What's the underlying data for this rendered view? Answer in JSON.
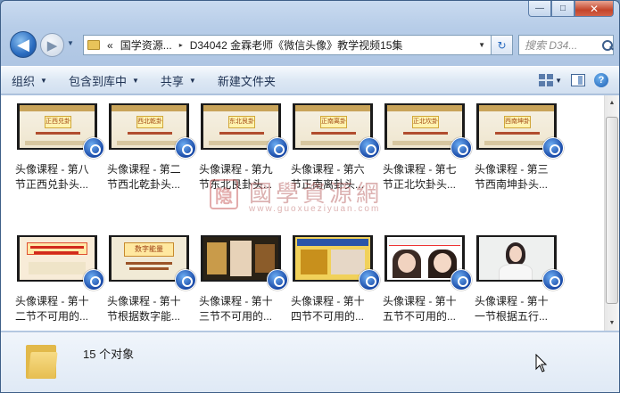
{
  "window": {
    "caption": {
      "minimize": "—",
      "maximize": "□",
      "close": "✕"
    }
  },
  "nav": {
    "back": "◀",
    "forward": "▶",
    "history_arrow": "▼",
    "breadcrumb": {
      "overflow": "«",
      "items": [
        "国学资源...",
        "D34042 金霖老师《微信头像》教学视频15集"
      ],
      "separator": "▸"
    },
    "address_dropdown": "▼",
    "refresh": "↻",
    "search_placeholder": "搜索 D34..."
  },
  "toolbar": {
    "organize": "组织",
    "include_library": "包含到库中",
    "share": "共享",
    "new_folder": "新建文件夹",
    "caret": "▼",
    "help": "?"
  },
  "files": [
    {
      "line1": "头像课程 - 第八",
      "line2": "节正西兑卦头...",
      "thumb": "slide",
      "title": "正西兑卦"
    },
    {
      "line1": "头像课程 - 第二",
      "line2": "节西北乾卦头...",
      "thumb": "slide",
      "title": "西北乾卦"
    },
    {
      "line1": "头像课程 - 第九",
      "line2": "节东北艮卦头...",
      "thumb": "slide",
      "title": "东北艮卦"
    },
    {
      "line1": "头像课程 - 第六",
      "line2": "节正南离卦头...",
      "thumb": "slide",
      "title": "正南离卦"
    },
    {
      "line1": "头像课程 - 第七",
      "line2": "节正北坎卦头...",
      "thumb": "slide",
      "title": "正北坎卦"
    },
    {
      "line1": "头像课程 - 第三",
      "line2": "节西南坤卦头...",
      "thumb": "slide",
      "title": "西南坤卦"
    },
    {
      "line1": "头像课程 - 第十",
      "line2": "二节不可用的...",
      "thumb": "red-text",
      "title": ""
    },
    {
      "line1": "头像课程 - 第十",
      "line2": "节根据数字能...",
      "thumb": "number",
      "title": "数字能量"
    },
    {
      "line1": "头像课程 - 第十",
      "line2": "三节不可用的...",
      "thumb": "photos-dark",
      "title": ""
    },
    {
      "line1": "头像课程 - 第十",
      "line2": "四节不可用的...",
      "thumb": "photos-gold",
      "title": ""
    },
    {
      "line1": "头像课程 - 第十",
      "line2": "五节不可用的...",
      "thumb": "portraits",
      "title": ""
    },
    {
      "line1": "头像课程 - 第十",
      "line2": "一节根据五行...",
      "thumb": "person",
      "title": ""
    }
  ],
  "status": {
    "count_text": "15 个对象"
  },
  "watermark": {
    "seal": "隐",
    "text": "國學資源網",
    "url": "www.guoxueziyuan.com"
  },
  "colors": {
    "accent": "#2a6cc0",
    "play_badge": "#1848a6"
  }
}
